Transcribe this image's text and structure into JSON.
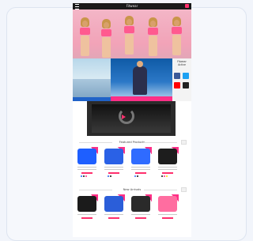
{
  "app": {
    "brand": "Fitwear"
  },
  "sections": {
    "featured": "Featured Products",
    "new": "New Arrivals"
  },
  "promo": {
    "logo_text": "Fitwear Active"
  },
  "products_row1": [
    {
      "color": "#1e5fff",
      "type": "jacket"
    },
    {
      "color": "#2a61e6",
      "type": "top"
    },
    {
      "color": "#2f6bff",
      "type": "shorts"
    },
    {
      "color": "#1d1d1d",
      "type": "top"
    }
  ],
  "products_row2": [
    {
      "color": "#1b1b1b",
      "type": "leggings"
    },
    {
      "color": "#2b5ed9",
      "type": "leggings"
    },
    {
      "color": "#2a2a2a",
      "type": "leggings"
    },
    {
      "color": "#ff6da0",
      "type": "top"
    }
  ],
  "icons": {
    "menu": "hamburger-menu-icon",
    "cart": "cart-icon",
    "video": "video-play-icon",
    "social": [
      "facebook-icon",
      "twitter-icon",
      "youtube-icon",
      "pinterest-icon"
    ]
  },
  "colors": {
    "accent": "#ff2f86",
    "topbar": "#1a1a1a",
    "hero": "#f2a3b8"
  }
}
